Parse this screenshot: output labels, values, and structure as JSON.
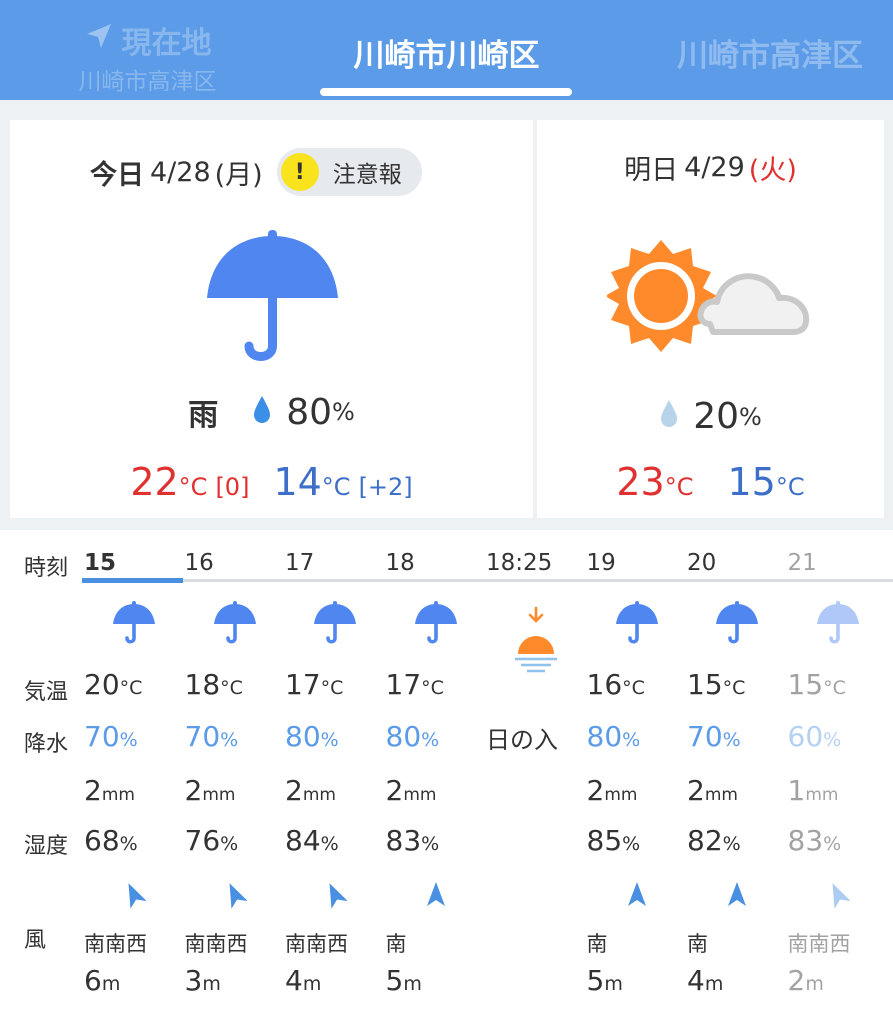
{
  "header": {
    "current_location_label": "現在地",
    "current_location_sub": "川崎市高津区",
    "selected_location": "川崎市川崎区",
    "next_location": "川崎市高津区"
  },
  "today": {
    "label": "今日",
    "date": "4/28",
    "weekday": "(月)",
    "alert_mark": "!",
    "alert_label": "注意報",
    "condition": "雨",
    "icon": "umbrella-icon",
    "precip": "80",
    "precip_unit": "%",
    "high": "22",
    "high_diff": "[0]",
    "low": "14",
    "low_diff": "[+2]",
    "temp_unit": "°C"
  },
  "tomorrow": {
    "label": "明日",
    "date": "4/29",
    "weekday": "(火)",
    "icon": "sun-cloud-icon",
    "precip": "20",
    "precip_unit": "%",
    "high": "23",
    "low": "15",
    "temp_unit": "°C"
  },
  "hourly_labels": {
    "time": "時刻",
    "temp": "気温",
    "precip": "降水",
    "humidity": "湿度",
    "wind": "風"
  },
  "units": {
    "temp": "°C",
    "pct": "%",
    "mm": "mm",
    "m": "m"
  },
  "hourly": [
    {
      "hour": "15",
      "icon": "umbrella-icon",
      "temp": "20",
      "prob": "70",
      "mm": "2",
      "hum": "68",
      "wdir": "南南西",
      "wspd": "6"
    },
    {
      "hour": "16",
      "icon": "umbrella-icon",
      "temp": "18",
      "prob": "70",
      "mm": "2",
      "hum": "76",
      "wdir": "南南西",
      "wspd": "3"
    },
    {
      "hour": "17",
      "icon": "umbrella-icon",
      "temp": "17",
      "prob": "80",
      "mm": "2",
      "hum": "84",
      "wdir": "南南西",
      "wspd": "4"
    },
    {
      "hour": "18",
      "icon": "umbrella-icon",
      "temp": "17",
      "prob": "80",
      "mm": "2",
      "hum": "83",
      "wdir": "南",
      "wspd": "5"
    },
    {
      "hour": "18:25",
      "icon": "sunset-icon",
      "sunset_label": "日の入"
    },
    {
      "hour": "19",
      "icon": "umbrella-icon",
      "temp": "16",
      "prob": "80",
      "mm": "2",
      "hum": "85",
      "wdir": "南",
      "wspd": "5"
    },
    {
      "hour": "20",
      "icon": "umbrella-icon",
      "temp": "15",
      "prob": "70",
      "mm": "2",
      "hum": "82",
      "wdir": "南",
      "wspd": "4"
    },
    {
      "hour": "21",
      "icon": "umbrella-icon",
      "temp": "15",
      "prob": "60",
      "mm": "1",
      "hum": "83",
      "wdir": "南南西",
      "wspd": "2"
    }
  ],
  "colors": {
    "header_bg": "#5b9be8",
    "accent_blue": "#4a90e2",
    "high_red": "#e03030",
    "low_blue": "#3d6fc9",
    "umbrella_blue": "#4f86ef",
    "sun_orange": "#ff8a2b"
  }
}
